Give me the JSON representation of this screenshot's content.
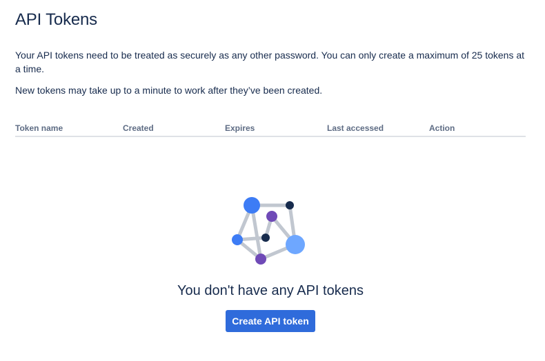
{
  "page": {
    "title": "API Tokens",
    "description_1": "Your API tokens need to be treated as securely as any other password. You can only create a maximum of 25 tokens at a time.",
    "description_2": "New tokens may take up to a minute to work after they’ve been created."
  },
  "table": {
    "columns": [
      "Token name",
      "Created",
      "Expires",
      "Last accessed",
      "Action"
    ]
  },
  "empty_state": {
    "illustration_icon": "network-graph-icon",
    "title": "You don't have any API tokens",
    "button_label": "Create API token"
  },
  "colors": {
    "primary_button": "#2f6bdb",
    "text": "#172b4d",
    "muted_text": "#5e6c84",
    "divider": "#dfe1e6",
    "illustration_blue": "#3d7cf5",
    "illustration_light_blue": "#6ea7ff",
    "illustration_purple": "#6f4ab7",
    "illustration_dark": "#172b4d",
    "illustration_lines": "#c1c7d0"
  }
}
